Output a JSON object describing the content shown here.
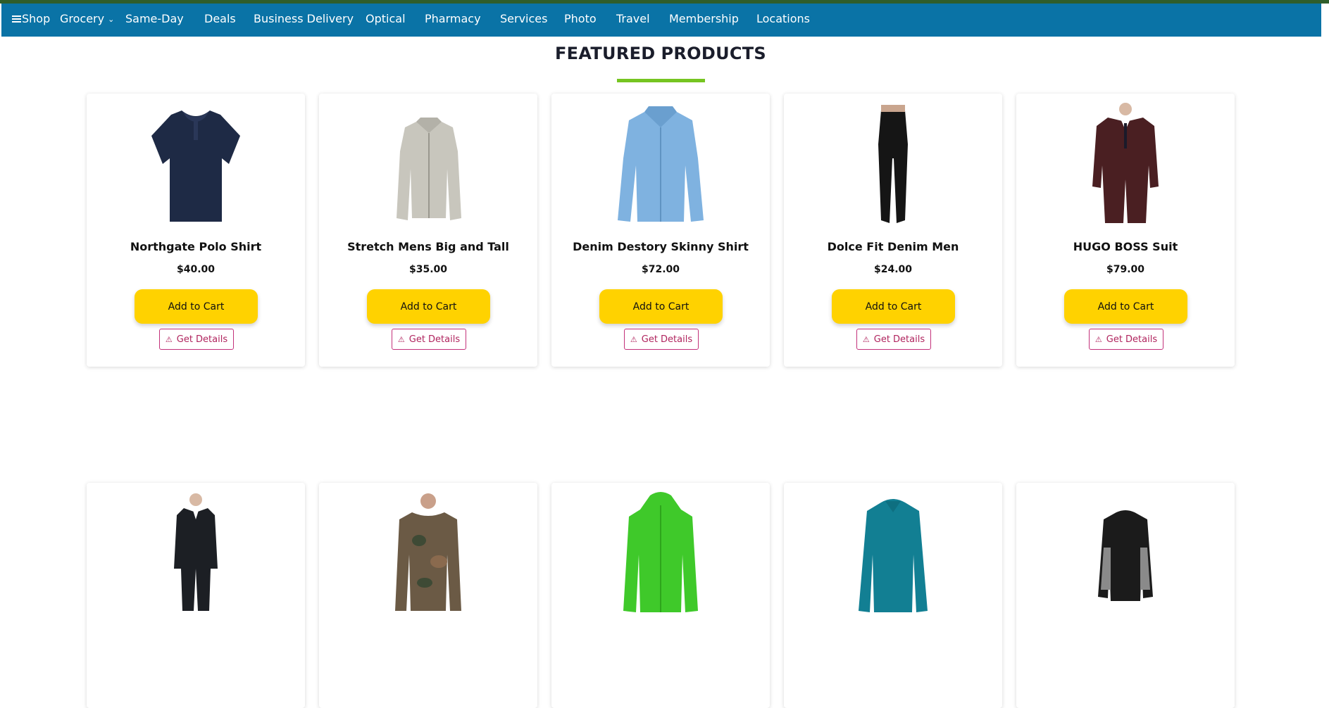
{
  "nav": {
    "shop": "Shop",
    "items": [
      "Grocery",
      "Same-Day",
      "Deals",
      "Business Delivery",
      "Optical",
      "Pharmacy",
      "Services",
      "Photo",
      "Travel",
      "Membership",
      "Locations"
    ]
  },
  "section": {
    "title_a": "FEATURED",
    "title_b": "PRODUCTS"
  },
  "products": [
    {
      "name": "Northgate Polo Shirt",
      "price": "$40.00",
      "image": "navy-polo-shirt"
    },
    {
      "name": "Stretch Mens Big and Tall",
      "price": "$35.00",
      "image": "checked-dress-shirt"
    },
    {
      "name": "Denim Destory Skinny Shirt",
      "price": "$72.00",
      "image": "blue-button-shirt"
    },
    {
      "name": "Dolce Fit Denim Men",
      "price": "$24.00",
      "image": "black-skinny-jeans"
    },
    {
      "name": "HUGO BOSS Suit",
      "price": "$79.00",
      "image": "burgundy-suit"
    }
  ],
  "products_row2": [
    {
      "image": "black-suit"
    },
    {
      "image": "camo-sweater"
    },
    {
      "image": "green-rain-jacket"
    },
    {
      "image": "teal-half-zip"
    },
    {
      "image": "black-track-jacket"
    }
  ],
  "buttons": {
    "add_to_cart": "Add to Cart",
    "get_details": "Get Details"
  },
  "colors": {
    "nav_bg": "#0a73a6",
    "cart_btn": "#ffd200",
    "accent_bar": "#76c521",
    "details_border": "#c3317a"
  }
}
